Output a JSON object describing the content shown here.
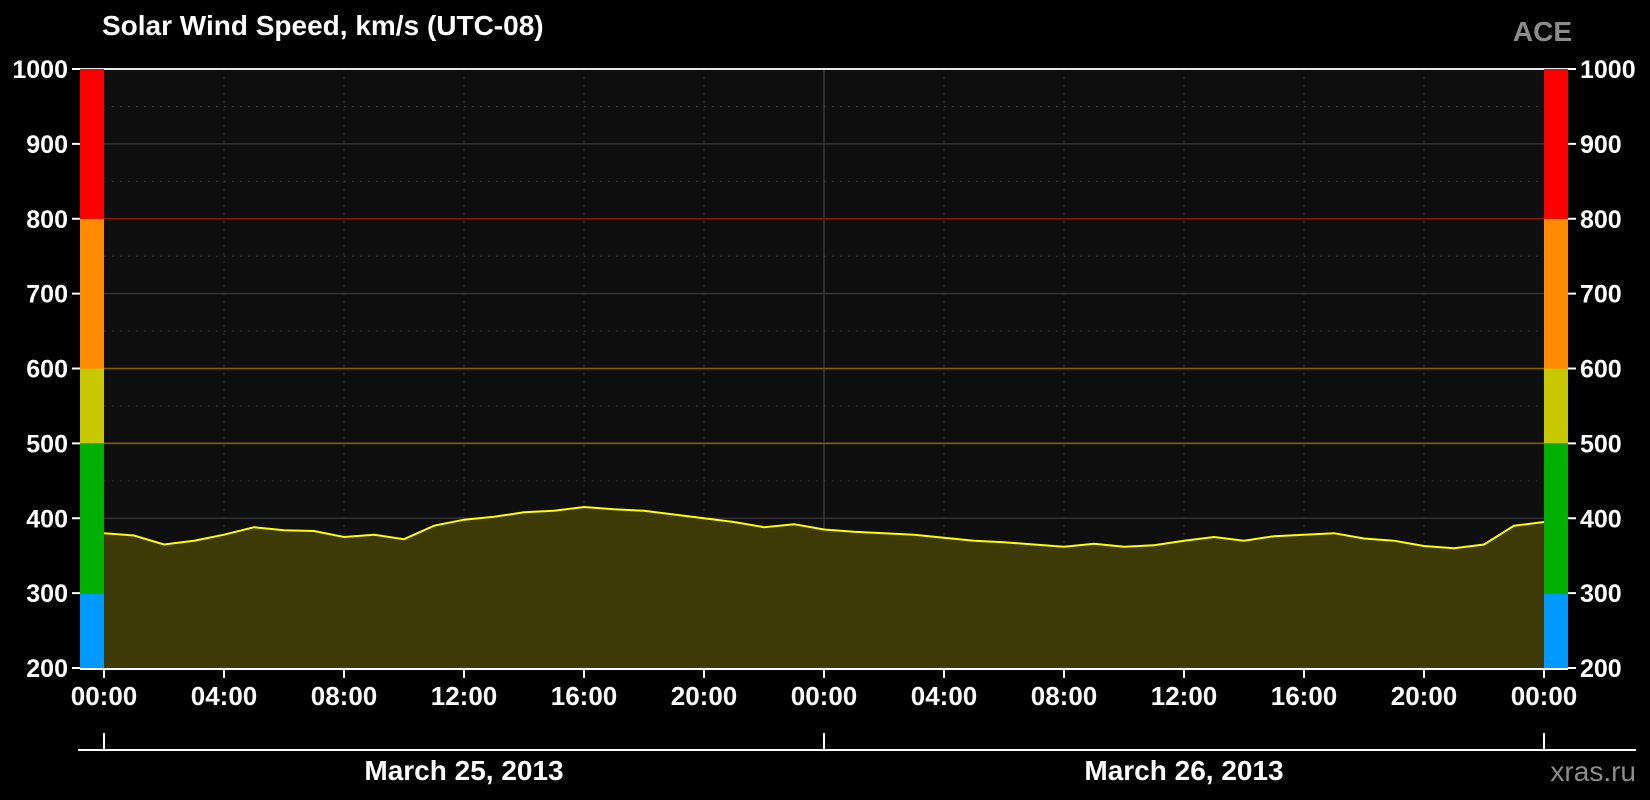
{
  "chart_data": {
    "type": "area",
    "title": "Solar Wind Speed, km/s (UTC-08)",
    "source": "ACE",
    "credit": "xras.ru",
    "ylim": [
      200,
      1000
    ],
    "yticks": [
      200,
      300,
      400,
      500,
      600,
      700,
      800,
      900,
      1000
    ],
    "xlim_hours": [
      0,
      48
    ],
    "xticks": [
      "00:00",
      "04:00",
      "08:00",
      "12:00",
      "16:00",
      "20:00",
      "00:00",
      "04:00",
      "08:00",
      "12:00",
      "16:00",
      "20:00",
      "00:00"
    ],
    "dates": [
      "March 25, 2013",
      "March 26, 2013"
    ],
    "grid": true,
    "threshold_lines": [
      {
        "value": 500,
        "color": "#7a6a00"
      },
      {
        "value": 600,
        "color": "#8a6000"
      },
      {
        "value": 800,
        "color": "#8a1a00"
      }
    ],
    "scale_bands": [
      {
        "from": 200,
        "to": 300,
        "color": "#0099ff"
      },
      {
        "from": 300,
        "to": 500,
        "color": "#00b000"
      },
      {
        "from": 500,
        "to": 600,
        "color": "#c8c800"
      },
      {
        "from": 600,
        "to": 800,
        "color": "#ff8c00"
      },
      {
        "from": 800,
        "to": 1000,
        "color": "#ff0000"
      }
    ],
    "series": [
      {
        "color": "#ffff00",
        "fill": "#3d3a06",
        "x_hours": [
          0,
          1,
          2,
          3,
          4,
          5,
          6,
          7,
          8,
          9,
          10,
          11,
          12,
          13,
          14,
          15,
          16,
          17,
          18,
          19,
          20,
          21,
          22,
          23,
          24,
          25,
          26,
          27,
          28,
          29,
          30,
          31,
          32,
          33,
          34,
          35,
          36,
          37,
          38,
          39,
          40,
          41,
          42,
          43,
          44,
          45,
          46,
          47,
          48
        ],
        "values": [
          380,
          377,
          365,
          370,
          378,
          388,
          384,
          383,
          375,
          378,
          372,
          390,
          398,
          402,
          408,
          410,
          415,
          412,
          410,
          405,
          400,
          395,
          388,
          392,
          385,
          382,
          380,
          378,
          374,
          370,
          368,
          365,
          362,
          366,
          362,
          364,
          370,
          375,
          370,
          376,
          378,
          380,
          373,
          370,
          363,
          360,
          365,
          390,
          395
        ]
      }
    ]
  }
}
